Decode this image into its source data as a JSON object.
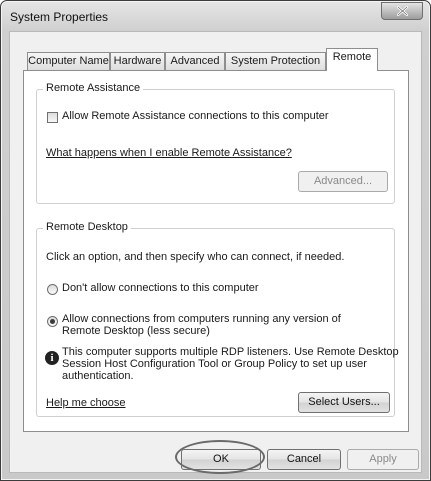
{
  "window": {
    "title": "System Properties",
    "close_icon": "close-icon"
  },
  "tabs": [
    {
      "label": "Computer Name"
    },
    {
      "label": "Hardware"
    },
    {
      "label": "Advanced"
    },
    {
      "label": "System Protection"
    },
    {
      "label": "Remote",
      "active": true
    }
  ],
  "remote_assistance": {
    "group_label": "Remote Assistance",
    "allow_checkbox_label": "Allow Remote Assistance connections to this computer",
    "allow_checked": false,
    "help_link": "What happens when I enable Remote Assistance?",
    "advanced_button": "Advanced..."
  },
  "remote_desktop": {
    "group_label": "Remote Desktop",
    "instruction": "Click an option, and then specify who can connect, if needed.",
    "option_dont_allow": "Don't allow connections to this computer",
    "option_allow_line1": "Allow connections from computers running any version of",
    "option_allow_line2": "Remote Desktop (less secure)",
    "selected_option": "allow",
    "info_line1": "This computer supports multiple RDP listeners. Use Remote Desktop",
    "info_line2": "Session Host Configuration Tool or Group Policy to set up user",
    "info_line3": "authentication.",
    "help_link": "Help me choose",
    "select_users_button": "Select Users..."
  },
  "footer": {
    "ok": "OK",
    "cancel": "Cancel",
    "apply": "Apply"
  }
}
